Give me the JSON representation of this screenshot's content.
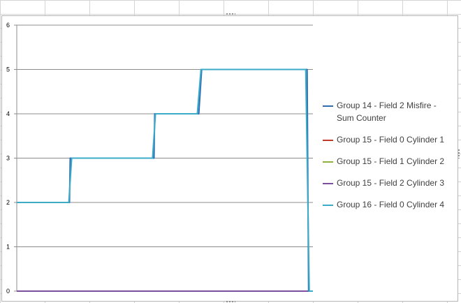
{
  "chart_data": {
    "type": "line",
    "title": "",
    "xlabel": "",
    "ylabel": "",
    "ylim": [
      0,
      6
    ],
    "yticks": [
      "0",
      "1",
      "2",
      "3",
      "4",
      "5",
      "6"
    ],
    "grid": "horizontal",
    "legend_position": "right",
    "series": [
      {
        "name": "Group 14 - Field 2 Misfire - Sum Counter",
        "color": "#2e6db4",
        "x": [
          0,
          73,
          74,
          190,
          191,
          252,
          256,
          400,
          402,
          404,
          406,
          410
        ],
        "values": [
          2,
          2,
          3,
          3,
          4,
          4,
          5,
          5,
          5,
          0,
          0,
          0
        ]
      },
      {
        "name": "Group 15 - Field 0 Cylinder 1",
        "color": "#c0392b",
        "x": [
          0,
          410
        ],
        "values": [
          0,
          0
        ]
      },
      {
        "name": "Group 15 - Field 1 Cylinder 2",
        "color": "#8db33c",
        "x": [
          0,
          410
        ],
        "values": [
          0,
          0
        ]
      },
      {
        "name": "Group 15 - Field 2 Cylinder 3",
        "color": "#7b4f9e",
        "x": [
          0,
          410
        ],
        "values": [
          0,
          0
        ]
      },
      {
        "name": "Group 16 - Field 0 Cylinder 4",
        "color": "#3cabc8",
        "x": [
          0,
          72,
          76,
          188,
          192,
          250,
          255,
          400,
          405,
          408,
          410
        ],
        "values": [
          2,
          2,
          3,
          3,
          4,
          4,
          5,
          5,
          0,
          0,
          0
        ]
      }
    ]
  }
}
